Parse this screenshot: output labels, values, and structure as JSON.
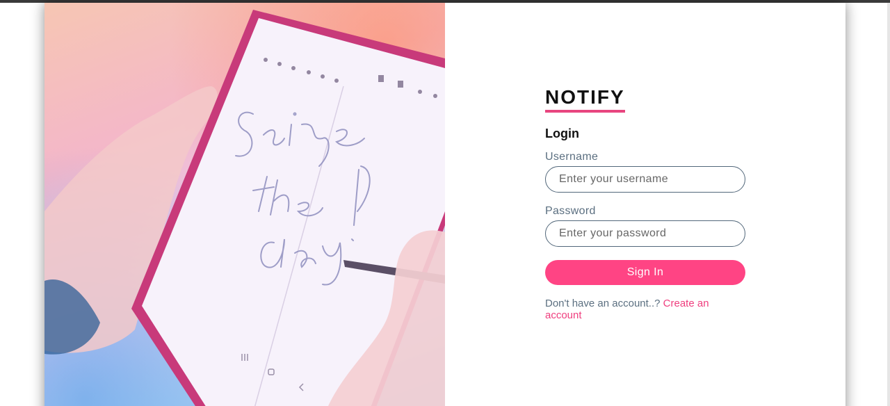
{
  "brand": {
    "name": "NOTIFY",
    "accent_color": "#e8457f"
  },
  "hero": {
    "image_description": "hands-holding-tablet-with-handwriting-photo",
    "handwriting": "Seize the day!"
  },
  "login": {
    "heading": "Login",
    "username": {
      "label": "Username",
      "placeholder": "Enter your username",
      "value": ""
    },
    "password": {
      "label": "Password",
      "placeholder": "Enter your password",
      "value": ""
    },
    "submit_label": "Sign In",
    "submit_color": "#ff4484",
    "signup_prompt": "Don't have an account..?",
    "signup_link": "Create an account"
  }
}
